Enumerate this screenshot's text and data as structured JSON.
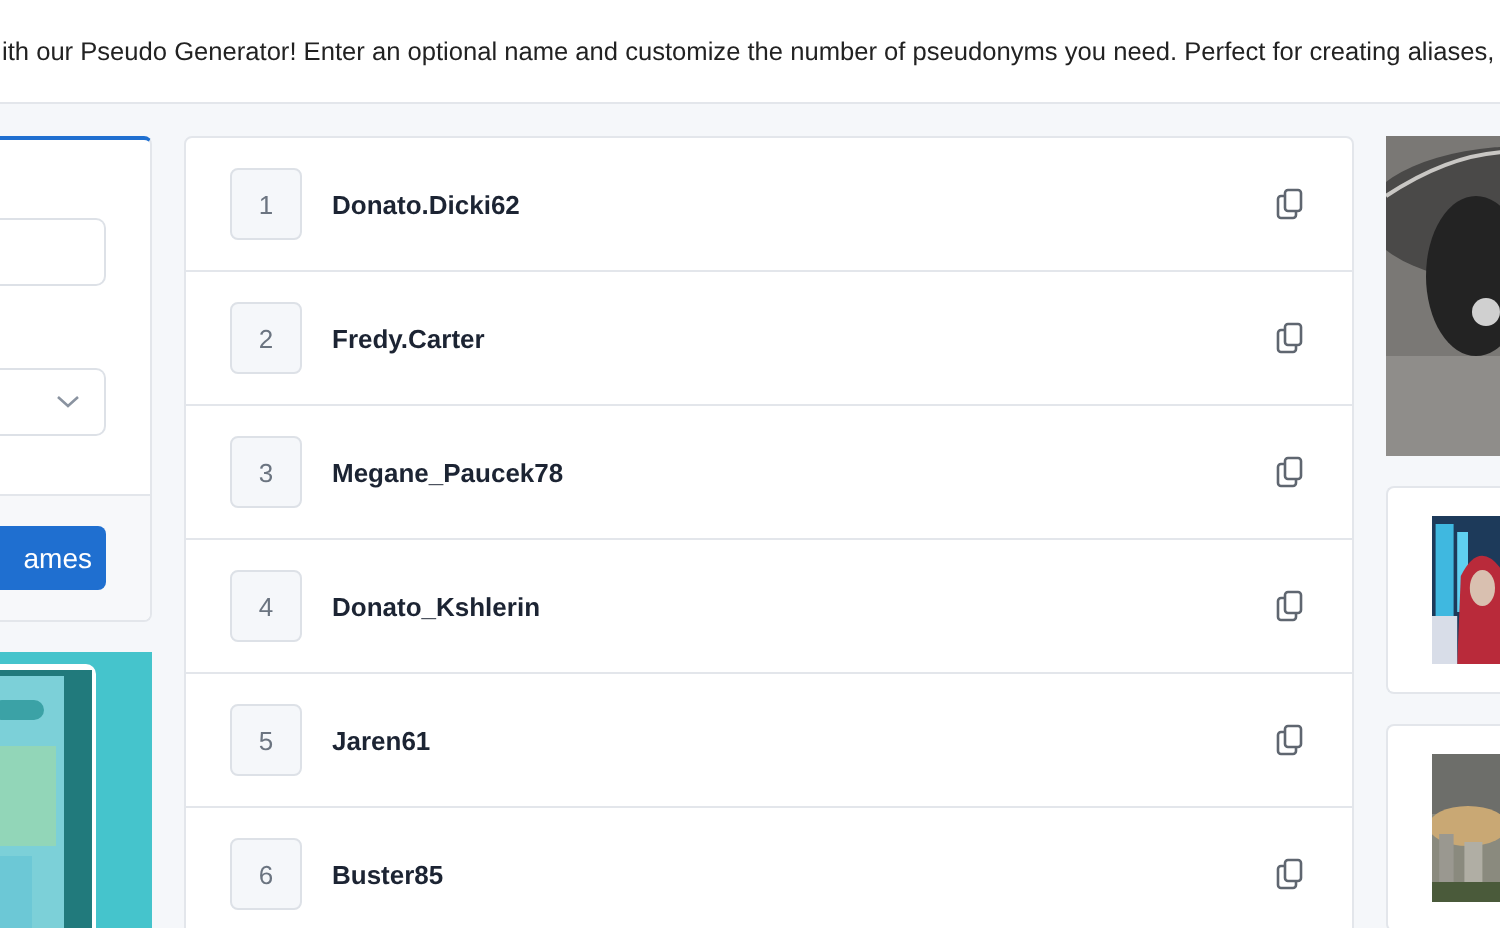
{
  "banner": {
    "text": "ith our Pseudo Generator! Enter an optional name and customize the number of pseudonyms you need. Perfect for creating aliases,"
  },
  "form": {
    "generate_button": "ames"
  },
  "results": [
    {
      "index": "1",
      "name": "Donato.Dicki62"
    },
    {
      "index": "2",
      "name": "Fredy.Carter"
    },
    {
      "index": "3",
      "name": "Megane_Paucek78"
    },
    {
      "index": "4",
      "name": "Donato_Kshlerin"
    },
    {
      "index": "5",
      "name": "Jaren61"
    },
    {
      "index": "6",
      "name": "Buster85"
    }
  ]
}
